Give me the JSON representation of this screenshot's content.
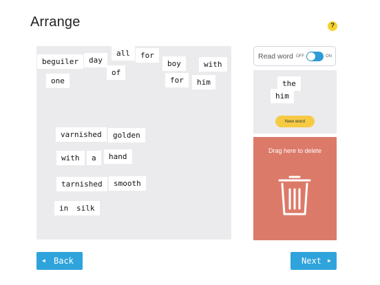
{
  "header": {
    "title": "Arrange",
    "help_label": "?"
  },
  "board": {
    "tiles": [
      "beguiler",
      "day",
      "all",
      "of",
      "for",
      "boy",
      "with",
      "one",
      "for",
      "him",
      "varnished",
      "golden",
      "with",
      "a",
      "hand",
      "tarnished",
      "smooth",
      "in",
      "silk"
    ]
  },
  "read_word": {
    "label": "Read word",
    "off_label": "OFF",
    "on_label": "ON",
    "enabled": true
  },
  "new_word_panel": {
    "tiles": [
      "the",
      "him"
    ],
    "button_label": "New word"
  },
  "delete_zone": {
    "label": "Drag here to delete",
    "icon": "trash-icon"
  },
  "nav": {
    "back_label": "Back",
    "next_label": "Next",
    "back_icon": "◀",
    "next_icon": "▶"
  },
  "colors": {
    "accent": "#2fa3dc",
    "delete": "#dc7a69",
    "new_word_button": "#f6ca45",
    "help": "#f6d32d",
    "board": "#ebebee"
  }
}
